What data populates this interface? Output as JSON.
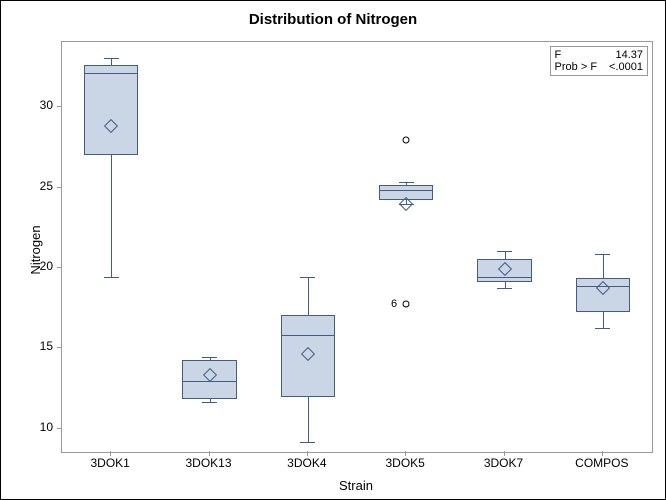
{
  "chart_data": {
    "type": "box",
    "title": "Distribution of Nitrogen",
    "xlabel": "Strain",
    "ylabel": "Nitrogen",
    "ylim": [
      8.5,
      34
    ],
    "yticks": [
      10,
      15,
      20,
      25,
      30
    ],
    "categories": [
      "3DOK1",
      "3DOK13",
      "3DOK4",
      "3DOK5",
      "3DOK7",
      "COMPOS"
    ],
    "boxes": [
      {
        "min": 19.4,
        "q1": 27.0,
        "median": 32.1,
        "q3": 32.6,
        "max": 33.0,
        "mean": 28.8,
        "outliers": []
      },
      {
        "min": 11.6,
        "q1": 11.8,
        "median": 12.9,
        "q3": 14.2,
        "max": 14.4,
        "mean": 13.3,
        "outliers": []
      },
      {
        "min": 9.1,
        "q1": 11.9,
        "median": 15.8,
        "q3": 17.0,
        "max": 19.4,
        "mean": 14.6,
        "outliers": []
      },
      {
        "min": 23.9,
        "q1": 24.2,
        "median": 24.8,
        "q3": 25.1,
        "max": 25.3,
        "mean": 23.9,
        "outliers": [
          27.9,
          17.7
        ],
        "outlier_labels": [
          "",
          "6"
        ]
      },
      {
        "min": 18.7,
        "q1": 19.1,
        "median": 19.4,
        "q3": 20.5,
        "max": 21.0,
        "mean": 19.9,
        "outliers": []
      },
      {
        "min": 16.2,
        "q1": 17.2,
        "median": 18.8,
        "q3": 19.3,
        "max": 20.8,
        "mean": 18.7,
        "outliers": []
      }
    ],
    "inset": {
      "stat1_label": "F",
      "stat1_value": "14.37",
      "stat2_label": "Prob > F",
      "stat2_value": "<.0001"
    }
  }
}
